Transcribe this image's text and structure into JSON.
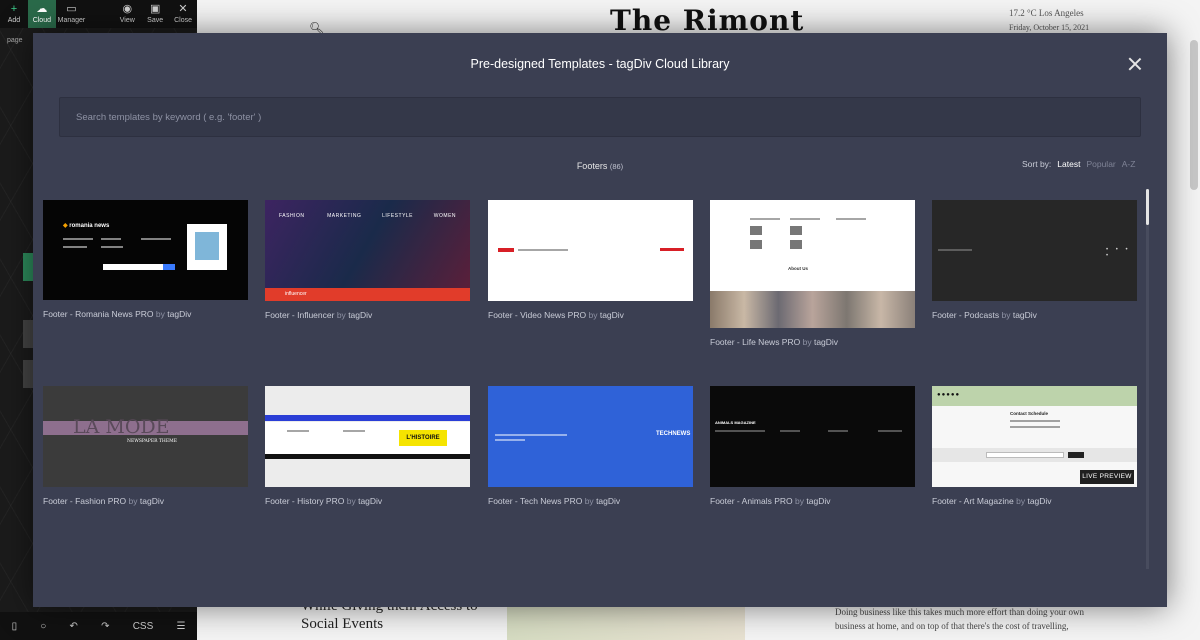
{
  "editor": {
    "toolbar": [
      {
        "label": "Add",
        "icon": "plus-icon",
        "glyph": "+"
      },
      {
        "label": "Cloud",
        "icon": "cloud-icon",
        "glyph": "☁"
      },
      {
        "label": "Manager",
        "icon": "layers-icon",
        "glyph": "▭"
      },
      {
        "label": "View",
        "icon": "eye-icon",
        "glyph": "◉"
      },
      {
        "label": "Save",
        "icon": "floppy-icon",
        "glyph": "▣"
      },
      {
        "label": "Close",
        "icon": "close-icon",
        "glyph": "✕"
      }
    ],
    "breadcrumb": "page",
    "bottom_bar": [
      {
        "icon": "mobile-icon",
        "glyph": "▯"
      },
      {
        "icon": "circle-icon",
        "glyph": "○"
      },
      {
        "icon": "undo-icon",
        "glyph": "↶"
      },
      {
        "icon": "redo-icon",
        "glyph": "↷"
      },
      {
        "icon": "css-icon",
        "glyph": "CSS"
      },
      {
        "icon": "list-icon",
        "glyph": "☰"
      }
    ]
  },
  "site": {
    "logo": "The Rimont",
    "weather": "17.2 °C  Los Angeles",
    "date": "Friday, October 15, 2021",
    "headline_line1": "While Giving them Access to",
    "headline_line2": "Social Events",
    "body_line1": "Doing business like this takes much more effort than doing your own",
    "body_line2": "business at home, and on top of that there's the cost of travelling,"
  },
  "modal": {
    "title": "Pre-designed Templates - tagDiv Cloud Library",
    "search_placeholder": "Search templates by keyword ( e.g. 'footer' )",
    "category": "Footers",
    "category_count": "(86)",
    "sort_label": "Sort by:",
    "sort_options": [
      "Latest",
      "Popular",
      "A-Z"
    ],
    "sort_active": "Latest",
    "by_text": "by",
    "author": "tagDiv",
    "live_preview_label": "LIVE PREVIEW",
    "templates": [
      {
        "name": "Footer - Romania News PRO",
        "thumb_text": "romania news"
      },
      {
        "name": "Footer - Influencer",
        "thumb_text": "influencer"
      },
      {
        "name": "Footer - Video News PRO",
        "thumb_text": ""
      },
      {
        "name": "Footer - Life News PRO",
        "thumb_text": "About Us"
      },
      {
        "name": "Footer - Podcasts",
        "thumb_text": ""
      },
      {
        "name": "Footer - Fashion PRO",
        "thumb_text": "LA MODE"
      },
      {
        "name": "Footer - History PRO",
        "thumb_text": "L'HISTOIRE"
      },
      {
        "name": "Footer - Tech News PRO",
        "thumb_text": "TECHNEWS"
      },
      {
        "name": "Footer - Animals PRO",
        "thumb_text": "ANIMALS MAGAZINE"
      },
      {
        "name": "Footer - Art Magazine",
        "thumb_text": "Contact Schedule"
      }
    ]
  }
}
